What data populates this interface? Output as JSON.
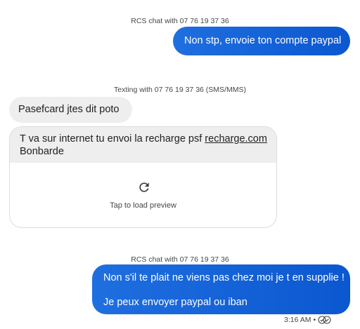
{
  "thread": {
    "rcs_status_1": "RCS chat with 07 76 19 37 36",
    "outgoing_1": "Non stp, envoie ton compte paypal",
    "sms_status": "Texting with 07 76 19 37 36 (SMS/MMS)",
    "incoming_1": "Pasefcard jtes dit poto",
    "incoming_2": {
      "text": "T va sur internet tu envoi la recharge psf",
      "link": "recharge.com",
      "second_line": "Bonbarde",
      "preview_label": "Tap to load preview",
      "preview_icon": "refresh-icon"
    },
    "rcs_status_2": "RCS chat with 07 76 19 37 36",
    "outgoing_2": {
      "line1": "Non s'il te plait ne viens pas chez moi je t en supplie !",
      "line2": "Je peux envoyer paypal ou iban"
    },
    "timestamp": "3:16 AM •",
    "read_icon": "double-check-icon"
  },
  "colors": {
    "outgoing_bubble": "#0b57d0",
    "incoming_bubble": "#eeeeee",
    "status_text": "#444746"
  }
}
